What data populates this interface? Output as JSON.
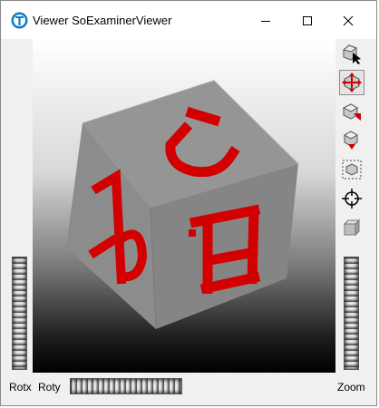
{
  "window": {
    "title": "Viewer SoExaminerViewer",
    "controls": {
      "minimize": "minimize",
      "maximize": "maximize",
      "close": "close"
    }
  },
  "toolbar": {
    "buttons": [
      {
        "name": "pick-mode",
        "icon": "arrow-pointer-cube-icon",
        "active": false
      },
      {
        "name": "view-mode",
        "icon": "rotate-arrows-icon",
        "active": true
      },
      {
        "name": "home",
        "icon": "home-view-icon",
        "active": false
      },
      {
        "name": "set-home",
        "icon": "set-home-icon",
        "active": false
      },
      {
        "name": "view-all",
        "icon": "view-all-icon",
        "active": false
      },
      {
        "name": "seek",
        "icon": "crosshair-seek-icon",
        "active": false
      },
      {
        "name": "projection",
        "icon": "perspective-cube-icon",
        "active": false
      }
    ]
  },
  "scene": {
    "cube_color": "#8f8f8f",
    "letter_color": "#d40000",
    "faces": {
      "top": "P",
      "left": "R",
      "right": "H"
    }
  },
  "labels": {
    "rotx": "Rotx",
    "roty": "Roty",
    "zoom": "Zoom"
  },
  "colors": {
    "background_top": "#ffffff",
    "background_bottom": "#000000"
  }
}
